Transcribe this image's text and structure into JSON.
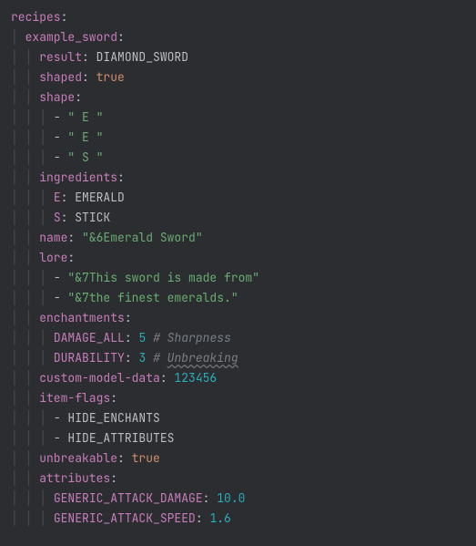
{
  "root": {
    "recipes_key": "recipes"
  },
  "recipe": {
    "id_key": "example_sword",
    "result_key": "result",
    "result_val": "DIAMOND_SWORD",
    "shaped_key": "shaped",
    "shaped_val": "true",
    "shape_key": "shape",
    "shape_rows": [
      "\" E \"",
      "\" E \"",
      "\" S \""
    ],
    "ingredients_key": "ingredients",
    "ingredients": {
      "E_key": "E",
      "E_val": "EMERALD",
      "S_key": "S",
      "S_val": "STICK"
    },
    "name_key": "name",
    "name_val": "\"&6Emerald Sword\"",
    "lore_key": "lore",
    "lore_lines": [
      "\"&7This sword is made from\"",
      "\"&7the finest emeralds.\""
    ],
    "enchantments_key": "enchantments",
    "enchantments": {
      "damage_key": "DAMAGE_ALL",
      "damage_val": "5",
      "damage_comment": "# Sharpness",
      "durability_key": "DURABILITY",
      "durability_val": "3",
      "durability_comment_hash": "# ",
      "durability_comment_word": "Unbreaking"
    },
    "cmd_key": "custom-model-data",
    "cmd_val": "123456",
    "item_flags_key": "item-flags",
    "item_flags": [
      "HIDE_ENCHANTS",
      "HIDE_ATTRIBUTES"
    ],
    "unbreakable_key": "unbreakable",
    "unbreakable_val": "true",
    "attributes_key": "attributes",
    "attributes": {
      "atk_dmg_key": "GENERIC_ATTACK_DAMAGE",
      "atk_dmg_val": "10.0",
      "atk_spd_key": "GENERIC_ATTACK_SPEED",
      "atk_spd_val": "1.6"
    }
  }
}
